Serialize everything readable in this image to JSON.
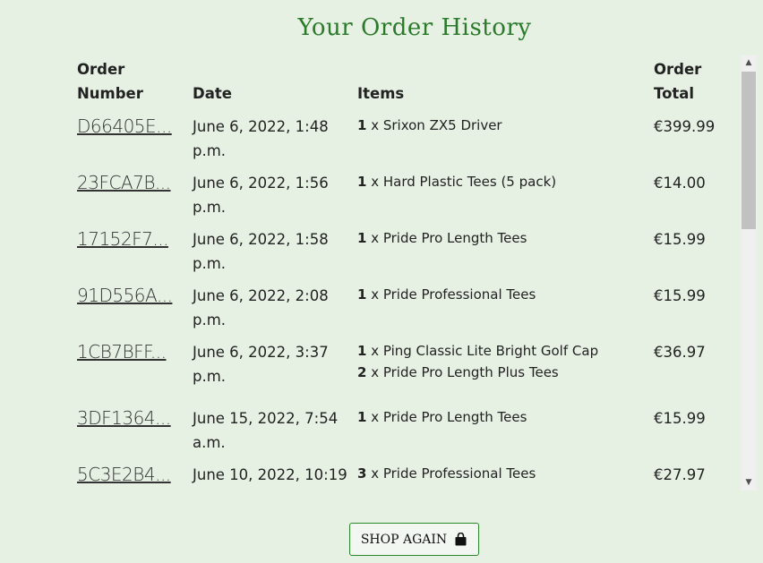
{
  "title": "Your Order History",
  "table": {
    "headers": {
      "order_number": "Order Number",
      "order_number_l1": "Order",
      "order_number_l2": "Number",
      "date": "Date",
      "items": "Items",
      "total_l1": "Order",
      "total_l2": "Total"
    },
    "rows": [
      {
        "order": "D66405E...",
        "date": "June 6, 2022, 1:48 p.m.",
        "items": [
          {
            "qty": "1",
            "name": " x Srixon ZX5 Driver"
          }
        ],
        "total": "€399.99"
      },
      {
        "order": "23FCA7B...",
        "date": "June 6, 2022, 1:56 p.m.",
        "items": [
          {
            "qty": "1",
            "name": " x Hard Plastic Tees (5 pack)"
          }
        ],
        "total": "€14.00"
      },
      {
        "order": "17152F7...",
        "date": "June 6, 2022, 1:58 p.m.",
        "items": [
          {
            "qty": "1",
            "name": " x Pride Pro Length Tees"
          }
        ],
        "total": "€15.99"
      },
      {
        "order": "91D556A...",
        "date": "June 6, 2022, 2:08 p.m.",
        "items": [
          {
            "qty": "1",
            "name": " x Pride Professional Tees"
          }
        ],
        "total": "€15.99"
      },
      {
        "order": "1CB7BFF...",
        "date": "June 6, 2022, 3:37 p.m.",
        "items": [
          {
            "qty": "1",
            "name": " x Ping Classic Lite Bright Golf Cap"
          },
          {
            "qty": "2",
            "name": " x Pride Pro Length Plus Tees"
          }
        ],
        "total": "€36.97"
      },
      {
        "order": "3DF1364...",
        "date": "June 15, 2022, 7:54 a.m.",
        "items": [
          {
            "qty": "1",
            "name": " x Pride Pro Length Tees"
          }
        ],
        "total": "€15.99"
      },
      {
        "order": "5C3E2B4...",
        "date": "June 10, 2022, 10:19",
        "items": [
          {
            "qty": "3",
            "name": " x Pride Professional Tees"
          }
        ],
        "total": "€27.97"
      }
    ]
  },
  "shop_again": {
    "label": "SHOP AGAIN",
    "icon": "shopping-bag-icon"
  },
  "colors": {
    "background": "#e6f1e4",
    "title": "#2a7a2a",
    "button_border": "#2a8a2a"
  }
}
